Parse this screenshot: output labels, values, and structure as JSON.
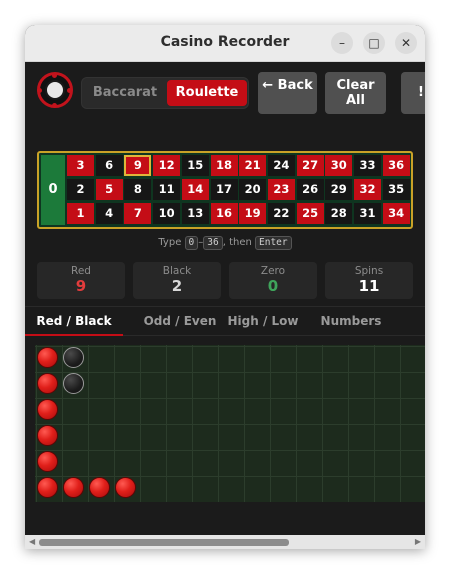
{
  "window": {
    "title": "Casino Recorder"
  },
  "window_controls": {
    "minimize": "–",
    "maximize": "□",
    "close": "✕"
  },
  "modes": {
    "baccarat": "Baccarat",
    "roulette": "Roulette",
    "active": "Roulette"
  },
  "toolbar": {
    "back_label": "← Back",
    "clear_label": "Clear All",
    "extra_label": "!"
  },
  "board": {
    "zero": "0",
    "selected_number": "9",
    "rows": [
      [
        {
          "n": "3",
          "c": "red"
        },
        {
          "n": "6",
          "c": "black"
        },
        {
          "n": "9",
          "c": "red"
        },
        {
          "n": "12",
          "c": "red"
        },
        {
          "n": "15",
          "c": "black"
        },
        {
          "n": "18",
          "c": "red"
        },
        {
          "n": "21",
          "c": "red"
        },
        {
          "n": "24",
          "c": "black"
        },
        {
          "n": "27",
          "c": "red"
        },
        {
          "n": "30",
          "c": "red"
        },
        {
          "n": "33",
          "c": "black"
        },
        {
          "n": "36",
          "c": "red"
        }
      ],
      [
        {
          "n": "2",
          "c": "black"
        },
        {
          "n": "5",
          "c": "red"
        },
        {
          "n": "8",
          "c": "black"
        },
        {
          "n": "11",
          "c": "black"
        },
        {
          "n": "14",
          "c": "red"
        },
        {
          "n": "17",
          "c": "black"
        },
        {
          "n": "20",
          "c": "black"
        },
        {
          "n": "23",
          "c": "red"
        },
        {
          "n": "26",
          "c": "black"
        },
        {
          "n": "29",
          "c": "black"
        },
        {
          "n": "32",
          "c": "red"
        },
        {
          "n": "35",
          "c": "black"
        }
      ],
      [
        {
          "n": "1",
          "c": "red"
        },
        {
          "n": "4",
          "c": "black"
        },
        {
          "n": "7",
          "c": "red"
        },
        {
          "n": "10",
          "c": "black"
        },
        {
          "n": "13",
          "c": "black"
        },
        {
          "n": "16",
          "c": "red"
        },
        {
          "n": "19",
          "c": "red"
        },
        {
          "n": "22",
          "c": "black"
        },
        {
          "n": "25",
          "c": "red"
        },
        {
          "n": "28",
          "c": "black"
        },
        {
          "n": "31",
          "c": "black"
        },
        {
          "n": "34",
          "c": "red"
        }
      ]
    ]
  },
  "hint": {
    "prefix": "Type",
    "key_from": "0",
    "dash": "–",
    "key_to": "36",
    "middle": ", then",
    "key_enter": "Enter"
  },
  "stats": [
    {
      "label": "Red",
      "value": "9",
      "color": "#e23c3c"
    },
    {
      "label": "Black",
      "value": "2",
      "color": "#d8d8d8"
    },
    {
      "label": "Zero",
      "value": "0",
      "color": "#3fa45b"
    },
    {
      "label": "Spins",
      "value": "11",
      "color": "#ffffff"
    }
  ],
  "tabs": [
    {
      "label": "Red / Black",
      "active": true
    },
    {
      "label": "Odd / Even",
      "active": false
    },
    {
      "label": "High / Low",
      "active": false
    },
    {
      "label": "Numbers",
      "active": false
    }
  ],
  "roadmap": {
    "columns": [
      [
        "red",
        "red",
        "red",
        "red",
        "red",
        "red"
      ],
      [
        "black",
        "black",
        "",
        "",
        "",
        "red"
      ],
      [
        "",
        "",
        "",
        "",
        "",
        "red"
      ],
      [
        "",
        "",
        "",
        "",
        "",
        "red"
      ]
    ]
  },
  "colors": {
    "accent": "#c40d16",
    "board_border": "#c9a227",
    "zero_green": "#1c7a3a"
  }
}
